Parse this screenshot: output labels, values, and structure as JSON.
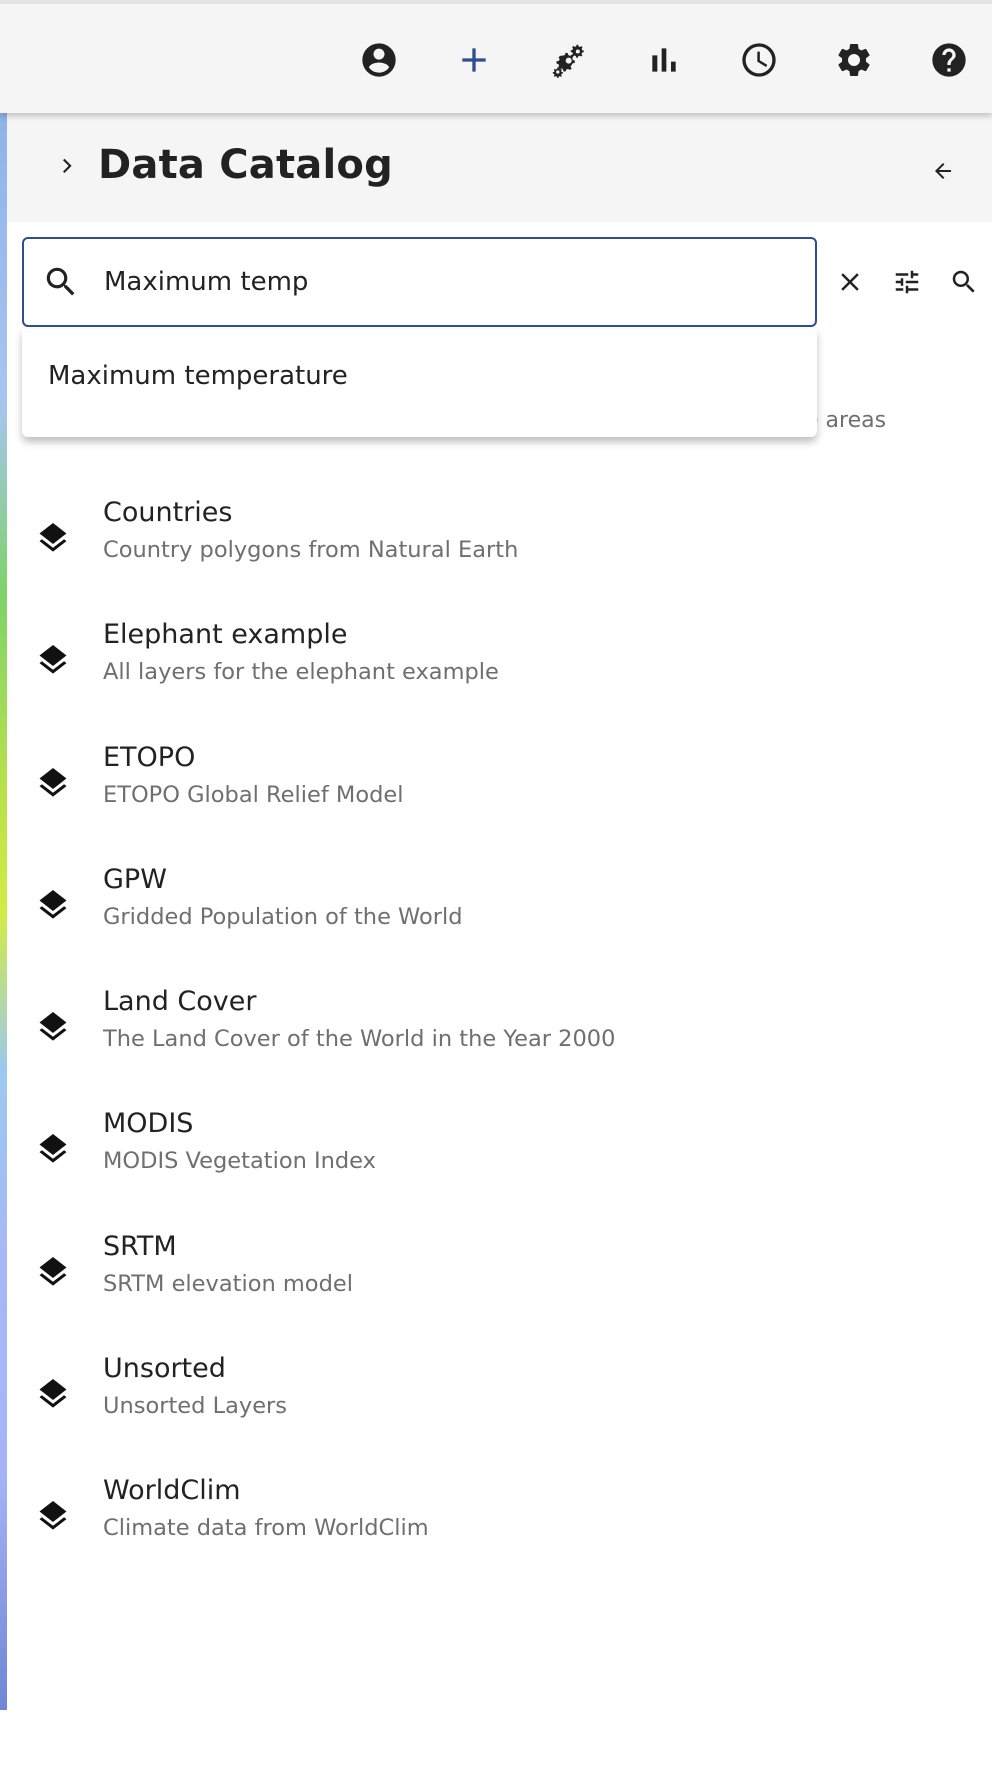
{
  "toolbar": {
    "icons": [
      "account-circle-icon",
      "add-icon",
      "gears-icon",
      "bar-chart-icon",
      "clock-icon",
      "settings-icon",
      "help-icon"
    ]
  },
  "colors": {
    "accent": "#2e4e8f",
    "toolbar_bg": "#f5f5f5",
    "text_primary": "#222222",
    "text_secondary": "#6f6f6f"
  },
  "drawer": {
    "title": "Data Catalog"
  },
  "search": {
    "value": "Maximum temp",
    "suggestion": "Maximum temperature"
  },
  "partially_hidden_item": {
    "subtitle_fragment": "e areas"
  },
  "catalog": {
    "items": [
      {
        "title": "Countries",
        "subtitle": "Country polygons from Natural Earth"
      },
      {
        "title": "Elephant example",
        "subtitle": "All layers for the elephant example"
      },
      {
        "title": "ETOPO",
        "subtitle": "ETOPO Global Relief Model"
      },
      {
        "title": "GPW",
        "subtitle": "Gridded Population of the World"
      },
      {
        "title": "Land Cover",
        "subtitle": "The Land Cover of the World in the Year 2000"
      },
      {
        "title": "MODIS",
        "subtitle": "MODIS Vegetation Index"
      },
      {
        "title": "SRTM",
        "subtitle": "SRTM elevation model"
      },
      {
        "title": "Unsorted",
        "subtitle": "Unsorted Layers"
      },
      {
        "title": "WorldClim",
        "subtitle": "Climate data from WorldClim"
      }
    ]
  }
}
